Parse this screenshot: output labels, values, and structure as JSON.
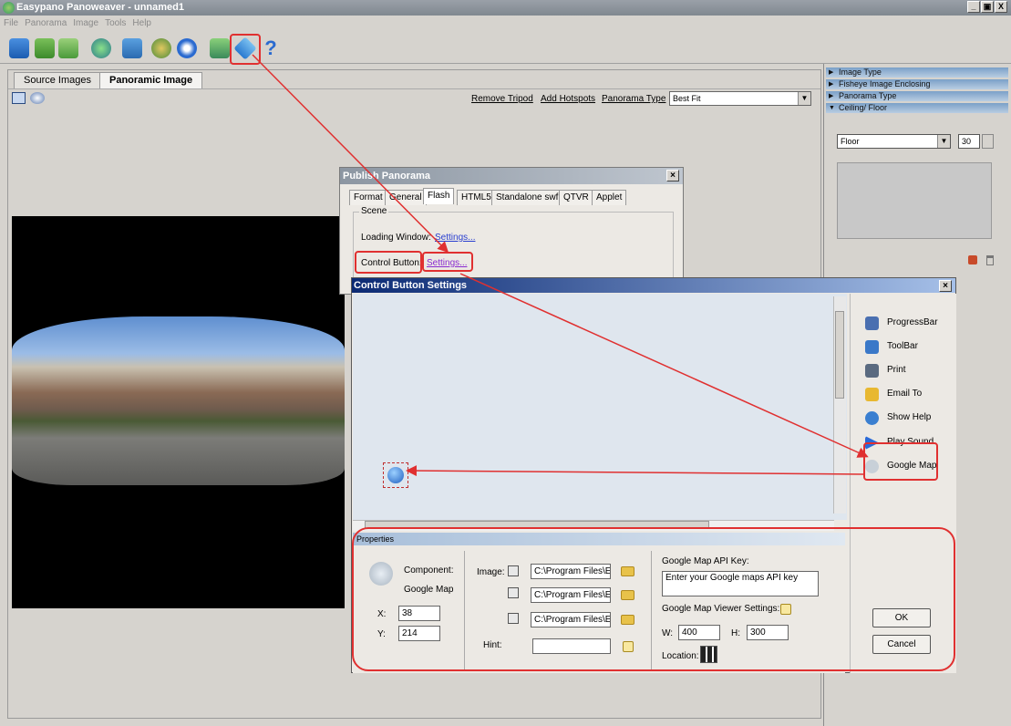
{
  "window": {
    "title": "Easypano Panoweaver - unnamed1",
    "controls": [
      "_",
      "▣",
      "X"
    ]
  },
  "menu": [
    "File",
    "Panorama",
    "Image",
    "Tools",
    "Help"
  ],
  "toolbar": {
    "icons": [
      "new-project-icon",
      "open-icon",
      "save-icon",
      "stitch-icon",
      "publish-icon",
      "batch-icon",
      "preview-icon",
      "flash-icon",
      "publish-flash-icon",
      "help-icon"
    ]
  },
  "left_tabs": [
    "Source Images",
    "Panoramic Image"
  ],
  "subbar": {
    "remove_tripod": "Remove Tripod",
    "add_hotspots": "Add Hotspots",
    "panorama_type": "Panorama Type",
    "fit_value": "Best Fit"
  },
  "right_sections": [
    "Image Type",
    "Fisheye Image Enclosing",
    "Panorama Type",
    "Ceiling/ Floor"
  ],
  "ceiling_floor": {
    "select": "Floor",
    "value": "30"
  },
  "publish": {
    "title": "Publish Panorama",
    "tabs": [
      "Format",
      "General",
      "Flash",
      "HTML5",
      "Standalone swf",
      "QTVR",
      "Applet"
    ],
    "scene_label": "Scene",
    "loading_window_label": "Loading Window:",
    "control_button_label": "Control Button:",
    "settings": "Settings..."
  },
  "cbs": {
    "title": "Control Button Settings",
    "items": [
      {
        "label": "ProgressBar",
        "icon": "progressbar-icon",
        "color": "#4a6fb0"
      },
      {
        "label": "ToolBar",
        "icon": "toolbar-icon",
        "color": "#3a78c8"
      },
      {
        "label": "Print",
        "icon": "print-icon",
        "color": "#5a6a80"
      },
      {
        "label": "Email To",
        "icon": "email-icon",
        "color": "#e8b830"
      },
      {
        "label": "Show Help",
        "icon": "help-icon",
        "color": "#3a7fd0"
      },
      {
        "label": "Play Sound",
        "icon": "sound-icon",
        "color": "#2a6ad8"
      },
      {
        "label": "Google Map",
        "icon": "google-map-icon",
        "color": "#c8d0d8"
      }
    ],
    "properties_label": "Properties",
    "component_label": "Component:",
    "component_value": "Google Map",
    "x_label": "X:",
    "x_value": "38",
    "y_label": "Y:",
    "y_value": "214",
    "image_label": "Image:",
    "image_paths": [
      "C:\\Program Files\\Ea",
      "C:\\Program Files\\Ea",
      "C:\\Program Files\\Ea"
    ],
    "hint_label": "Hint:",
    "hint_value": "",
    "api_key_label": "Google Map API Key:",
    "api_key_value": "Enter your Google maps API key",
    "viewer_settings_label": "Google Map Viewer Settings:",
    "w_label": "W:",
    "w_value": "400",
    "h_label": "H:",
    "h_value": "300",
    "location_label": "Location:",
    "ok": "OK",
    "cancel": "Cancel"
  },
  "colors": {
    "annotation": "#e03030",
    "dialog_caption": "#0b2a74"
  }
}
